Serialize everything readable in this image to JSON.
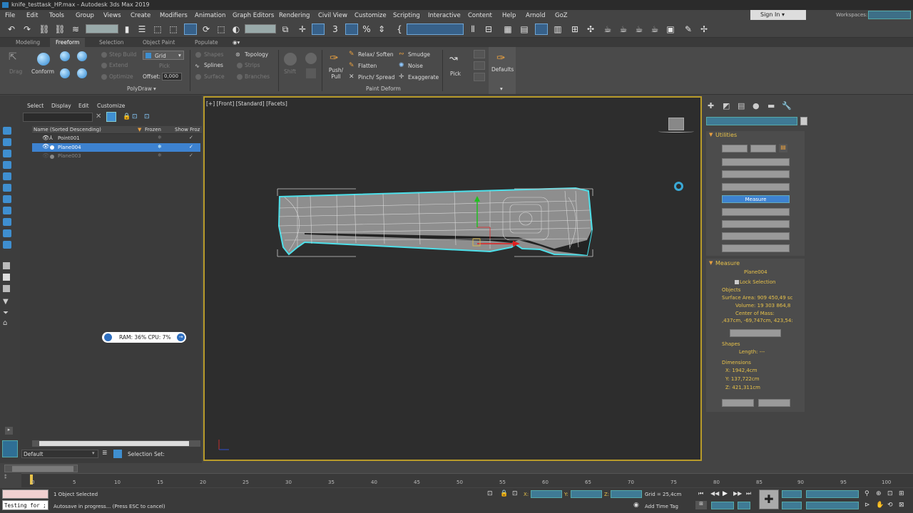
{
  "window": {
    "title": "knife_testtask_HP.max - Autodesk 3ds Max 2019"
  },
  "menu": [
    "File",
    "Edit",
    "Tools",
    "Group",
    "Views",
    "Create",
    "Modifiers",
    "Animation",
    "Graph Editors",
    "Rendering",
    "Civil View",
    "Customize",
    "Scripting",
    "Interactive",
    "Content",
    "Help",
    "Arnold",
    "GoZ"
  ],
  "account": {
    "sign_in": "Sign In",
    "workspaces_label": "Workspaces:"
  },
  "ribbon_tabs": [
    "Modeling",
    "Freeform",
    "Selection",
    "Object Paint",
    "Populate"
  ],
  "ribbon": {
    "drag": "Drag",
    "conform": "Conform",
    "step_build": "Step Build",
    "extend": "Extend",
    "optimize": "Optimize",
    "grid": "Grid",
    "pick": "Pick",
    "offset_label": "Offset:",
    "offset_value": "0,000",
    "shapes": "Shapes",
    "splines": "Splines",
    "surface": "Surface",
    "topology": "Topology",
    "strips": "Strips",
    "branches": "Branches",
    "polydraw": "PolyDraw",
    "shift": "Shift",
    "push_pull": "Push/ Pull",
    "relax_soften": "Relax/ Soften",
    "flatten": "Flatten",
    "pinch_spread": "Pinch/ Spread",
    "smudge": "Smudge",
    "noise": "Noise",
    "exaggerate": "Exaggerate",
    "paint_deform": "Paint Deform",
    "pick2": "Pick",
    "defaults": "Defaults"
  },
  "scene_explorer": {
    "menu": [
      "Select",
      "Display",
      "Edit",
      "Customize"
    ],
    "col_name": "Name (Sorted Descending)",
    "col_frozen": "Frozen",
    "col_show": "Show Froz",
    "rows": [
      {
        "name": "Point001",
        "selected": false
      },
      {
        "name": "Plane004",
        "selected": true
      },
      {
        "name": "Plane003",
        "selected": false
      }
    ],
    "layer": "Default",
    "selection_set": "Selection Set:"
  },
  "perf": {
    "text": "RAM: 36%  CPU: 7%"
  },
  "viewport": {
    "label": "[+] [Front] [Standard] [Facets]"
  },
  "command_panel": {
    "utilities_title": "Utilities",
    "measure_button": "Measure",
    "measure_title": "Measure",
    "object_name": "Plane004",
    "lock_selection": "Lock Selection",
    "objects_label": "Objects",
    "surface_area": "Surface Area: 909 450,49 sc",
    "volume": "Volume:  19 303 864,8",
    "center_mass_label": "Center of Mass:",
    "center_mass_value": ",437cm, -69,747cm, 423,54:",
    "shapes_label": "Shapes",
    "length": "Length: ---",
    "dimensions_label": "Dimensions",
    "dim_x": "X:   1942,4cm",
    "dim_y": "Y:   137,722cm",
    "dim_z": "Z:   421,311cm"
  },
  "timeline": {
    "ticks": [
      "0",
      "5",
      "10",
      "15",
      "20",
      "25",
      "30",
      "35",
      "40",
      "45",
      "50",
      "55",
      "60",
      "65",
      "70",
      "75",
      "80",
      "85",
      "90",
      "95",
      "100"
    ]
  },
  "status": {
    "objects_selected": "1 Object Selected",
    "autosave": "Autosave in progress... (Press ESC to cancel)",
    "listener": "Testing for ;",
    "grid": "Grid = 25,4cm",
    "add_time_tag": "Add Time Tag",
    "x_label": "X:",
    "y_label": "Y:",
    "z_label": "Z:"
  }
}
